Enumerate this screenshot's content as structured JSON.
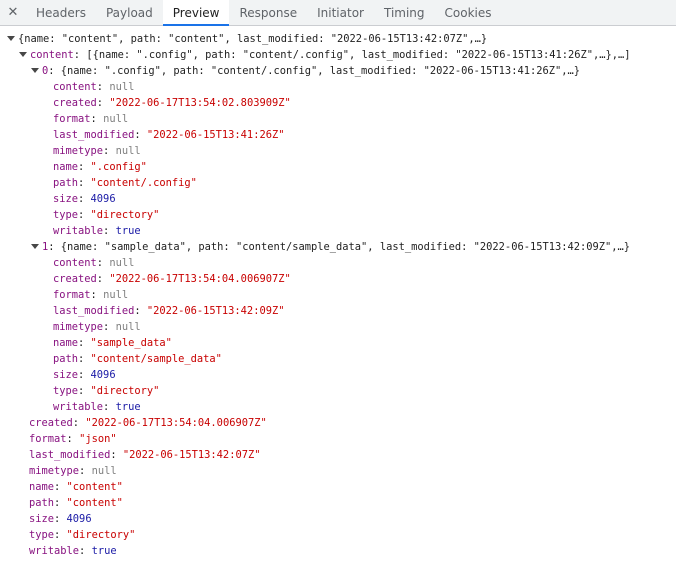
{
  "tabs": {
    "close": "✕",
    "items": [
      "Headers",
      "Payload",
      "Preview",
      "Response",
      "Initiator",
      "Timing",
      "Cookies"
    ],
    "active": "Preview"
  },
  "tree": {
    "root_summary": "{name: \"content\", path: \"content\", last_modified: \"2022-06-15T13:42:07Z\",…}",
    "content_key": "content",
    "content_summary": "[{name: \".config\", path: \"content/.config\", last_modified: \"2022-06-15T13:41:26Z\",…},…]",
    "items": [
      {
        "index": "0",
        "summary": "{name: \".config\", path: \"content/.config\", last_modified: \"2022-06-15T13:41:26Z\",…}",
        "props": [
          {
            "key": "content",
            "value": "null",
            "kind": "nul"
          },
          {
            "key": "created",
            "value": "\"2022-06-17T13:54:02.803909Z\"",
            "kind": "str"
          },
          {
            "key": "format",
            "value": "null",
            "kind": "nul"
          },
          {
            "key": "last_modified",
            "value": "\"2022-06-15T13:41:26Z\"",
            "kind": "str"
          },
          {
            "key": "mimetype",
            "value": "null",
            "kind": "nul"
          },
          {
            "key": "name",
            "value": "\".config\"",
            "kind": "str"
          },
          {
            "key": "path",
            "value": "\"content/.config\"",
            "kind": "str"
          },
          {
            "key": "size",
            "value": "4096",
            "kind": "num"
          },
          {
            "key": "type",
            "value": "\"directory\"",
            "kind": "str"
          },
          {
            "key": "writable",
            "value": "true",
            "kind": "bool"
          }
        ]
      },
      {
        "index": "1",
        "summary": "{name: \"sample_data\", path: \"content/sample_data\", last_modified: \"2022-06-15T13:42:09Z\",…}",
        "props": [
          {
            "key": "content",
            "value": "null",
            "kind": "nul"
          },
          {
            "key": "created",
            "value": "\"2022-06-17T13:54:04.006907Z\"",
            "kind": "str"
          },
          {
            "key": "format",
            "value": "null",
            "kind": "nul"
          },
          {
            "key": "last_modified",
            "value": "\"2022-06-15T13:42:09Z\"",
            "kind": "str"
          },
          {
            "key": "mimetype",
            "value": "null",
            "kind": "nul"
          },
          {
            "key": "name",
            "value": "\"sample_data\"",
            "kind": "str"
          },
          {
            "key": "path",
            "value": "\"content/sample_data\"",
            "kind": "str"
          },
          {
            "key": "size",
            "value": "4096",
            "kind": "num"
          },
          {
            "key": "type",
            "value": "\"directory\"",
            "kind": "str"
          },
          {
            "key": "writable",
            "value": "true",
            "kind": "bool"
          }
        ]
      }
    ],
    "root_props": [
      {
        "key": "created",
        "value": "\"2022-06-17T13:54:04.006907Z\"",
        "kind": "str"
      },
      {
        "key": "format",
        "value": "\"json\"",
        "kind": "str"
      },
      {
        "key": "last_modified",
        "value": "\"2022-06-15T13:42:07Z\"",
        "kind": "str"
      },
      {
        "key": "mimetype",
        "value": "null",
        "kind": "nul"
      },
      {
        "key": "name",
        "value": "\"content\"",
        "kind": "str"
      },
      {
        "key": "path",
        "value": "\"content\"",
        "kind": "str"
      },
      {
        "key": "size",
        "value": "4096",
        "kind": "num"
      },
      {
        "key": "type",
        "value": "\"directory\"",
        "kind": "str"
      },
      {
        "key": "writable",
        "value": "true",
        "kind": "bool"
      }
    ]
  }
}
